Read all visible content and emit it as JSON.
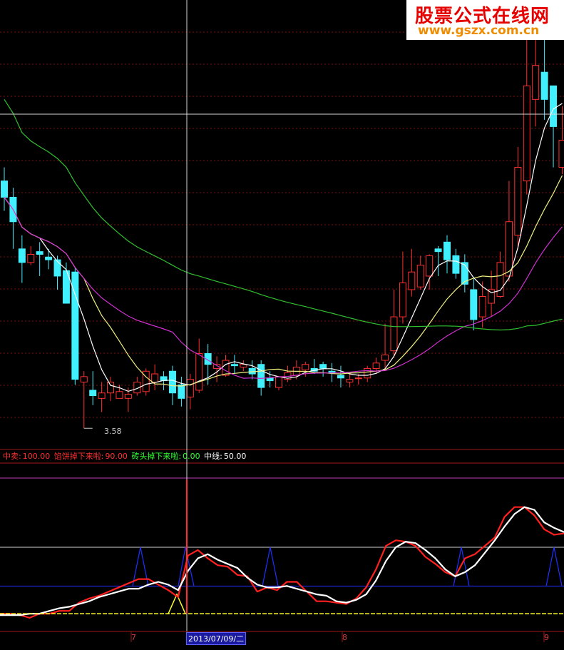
{
  "watermark": {
    "title": "股票公式在线网",
    "url": "www.gszx.com.cn"
  },
  "colors": {
    "up": "#ff3030",
    "down": "#40f0ff",
    "ma_short": "#ffffff",
    "ma_mid": "#f0f080",
    "ma_long": "#d030d0",
    "ma_longest": "#30c030",
    "grid": "#7a1010"
  },
  "indicator_legend": {
    "zhongmai_label": "中卖:",
    "zhongmai_value": "100.00",
    "xianbing_label": "馅饼掉下来啦:",
    "xianbing_value": "90.00",
    "zhuantou_label": "砖头掉下来啦:",
    "zhuantou_value": "0.00",
    "zhongxian_label": "中线:",
    "zhongxian_value": "50.00"
  },
  "annotations": {
    "low_price": "3.58"
  },
  "x_axis": {
    "tick_7": "7",
    "tick_8": "8",
    "tick_9": "9",
    "cursor_date": "2013/07/09/二"
  },
  "chart_data": [
    {
      "type": "candlestick",
      "title": "",
      "y_unit": "price",
      "ylim": [
        3.45,
        6.7
      ],
      "x": [
        0,
        1,
        2,
        3,
        4,
        5,
        6,
        7,
        8,
        9,
        10,
        11,
        12,
        13,
        14,
        15,
        16,
        17,
        18,
        19,
        20,
        21,
        22,
        23,
        24,
        25,
        26,
        27,
        28,
        29,
        30,
        31,
        32,
        33,
        34,
        35,
        36,
        37,
        38,
        39,
        40,
        41,
        42,
        43,
        44,
        45,
        46,
        47,
        48,
        49,
        50,
        51,
        52,
        53,
        54,
        55,
        56,
        57,
        58,
        59,
        60,
        61,
        62,
        63
      ],
      "open": [
        5.4,
        5.28,
        4.9,
        4.8,
        4.88,
        4.84,
        4.82,
        4.74,
        4.73,
        3.92,
        3.86,
        3.8,
        3.84,
        3.8,
        3.8,
        3.84,
        3.85,
        3.92,
        3.96,
        4.0,
        3.9,
        3.81,
        3.86,
        4.13,
        4.02,
        3.97,
        4.05,
        4.03,
        4.02,
        4.05,
        3.95,
        3.88,
        3.94,
        3.97,
        4.01,
        4.02,
        4.05,
        4.0,
        3.97,
        3.92,
        3.95,
        3.95,
        4.02,
        4.08,
        4.15,
        4.4,
        4.6,
        4.62,
        4.7,
        4.9,
        4.95,
        4.85,
        4.8,
        4.6,
        4.4,
        4.5,
        4.55,
        4.7,
        5.0,
        5.4,
        6.0,
        6.2,
        6.1,
        5.5
      ],
      "close": [
        5.28,
        5.1,
        4.8,
        4.86,
        4.86,
        4.82,
        4.7,
        4.5,
        3.94,
        3.96,
        3.82,
        3.84,
        3.92,
        3.85,
        3.83,
        3.92,
        4.0,
        3.98,
        3.93,
        3.84,
        3.8,
        3.94,
        4.13,
        4.05,
        4.05,
        4.08,
        4.04,
        4.05,
        3.98,
        3.88,
        3.93,
        3.96,
        3.99,
        4.03,
        4.05,
        4.0,
        4.02,
        3.99,
        3.95,
        3.94,
        3.95,
        4.02,
        4.06,
        4.12,
        4.4,
        4.65,
        4.73,
        4.78,
        4.85,
        4.88,
        4.82,
        4.72,
        4.64,
        4.38,
        4.55,
        4.6,
        4.8,
        5.1,
        5.5,
        6.1,
        6.25,
        6.0,
        5.8,
        5.7
      ],
      "high": [
        5.5,
        5.35,
        5.0,
        4.92,
        4.95,
        4.9,
        4.85,
        4.8,
        4.76,
        4.0,
        4.0,
        3.92,
        3.96,
        3.9,
        3.88,
        3.96,
        4.02,
        4.05,
        4.0,
        4.04,
        3.96,
        3.98,
        4.24,
        4.2,
        4.11,
        4.12,
        4.12,
        4.08,
        4.08,
        4.08,
        4.0,
        3.96,
        4.04,
        4.08,
        4.07,
        4.09,
        4.07,
        4.06,
        4.04,
        3.98,
        3.98,
        4.04,
        4.1,
        4.35,
        4.6,
        4.88,
        4.9,
        4.85,
        4.86,
        4.92,
        5.0,
        4.9,
        4.86,
        4.68,
        4.66,
        4.74,
        4.88,
        5.4,
        5.65,
        6.45,
        6.62,
        6.58,
        6.08,
        5.95
      ],
      "low": [
        5.18,
        4.9,
        4.65,
        4.78,
        4.7,
        4.75,
        4.6,
        4.5,
        3.9,
        3.58,
        3.75,
        3.7,
        3.78,
        3.8,
        3.7,
        3.82,
        3.82,
        3.86,
        3.86,
        3.75,
        3.74,
        3.72,
        3.84,
        3.9,
        3.92,
        3.96,
        3.98,
        4.0,
        3.94,
        3.82,
        3.88,
        3.86,
        3.92,
        3.94,
        3.96,
        3.98,
        3.96,
        3.92,
        3.88,
        3.88,
        3.9,
        3.92,
        3.98,
        4.02,
        4.1,
        4.35,
        4.55,
        4.6,
        4.6,
        4.7,
        4.72,
        4.68,
        4.58,
        4.3,
        4.32,
        4.4,
        4.54,
        4.66,
        4.9,
        5.3,
        5.8,
        5.85,
        5.5,
        5.45
      ]
    },
    {
      "type": "line",
      "title": "",
      "ylim": [
        0,
        100
      ],
      "series": [
        {
          "name": "",
          "color": "#ff2020",
          "values": [
            2,
            2,
            1,
            -1,
            2,
            2,
            4,
            4,
            10,
            13,
            15,
            18,
            21,
            24,
            27,
            27,
            23,
            19,
            14,
            44,
            48,
            42,
            37,
            36,
            30,
            29,
            18,
            21,
            19,
            25,
            25,
            18,
            11,
            11,
            10,
            9,
            13,
            21,
            34,
            51,
            55,
            54,
            51,
            43,
            38,
            32,
            29,
            42,
            45,
            51,
            57,
            72,
            79,
            79,
            73,
            63,
            59,
            60
          ]
        },
        {
          "name": "",
          "color": "#ffffff",
          "values": [
            1,
            1,
            1,
            2,
            2,
            4,
            6,
            7,
            9,
            11,
            14,
            16,
            18,
            20,
            20,
            23,
            25,
            23,
            19,
            33,
            42,
            45,
            41,
            38,
            35,
            28,
            23,
            21,
            21,
            22,
            20,
            18,
            16,
            15,
            11,
            10,
            12,
            16,
            26,
            40,
            50,
            54,
            53,
            48,
            42,
            34,
            29,
            32,
            37,
            46,
            55,
            65,
            74,
            79,
            77,
            68,
            64,
            61
          ]
        },
        {
          "name": "",
          "color": "#ffff30",
          "values": [
            2,
            2,
            2,
            2,
            2,
            2,
            2,
            2,
            2,
            2,
            2,
            2,
            2,
            2,
            2,
            2,
            2,
            2,
            2,
            2,
            2,
            2,
            2,
            2,
            2,
            2,
            2,
            2,
            2,
            2,
            2,
            2,
            2,
            2,
            2,
            2,
            2,
            2,
            2,
            2,
            2,
            2,
            2,
            2,
            2,
            2,
            2,
            2,
            2,
            2,
            2,
            2,
            2,
            2,
            2,
            2,
            2,
            2
          ]
        }
      ]
    }
  ]
}
